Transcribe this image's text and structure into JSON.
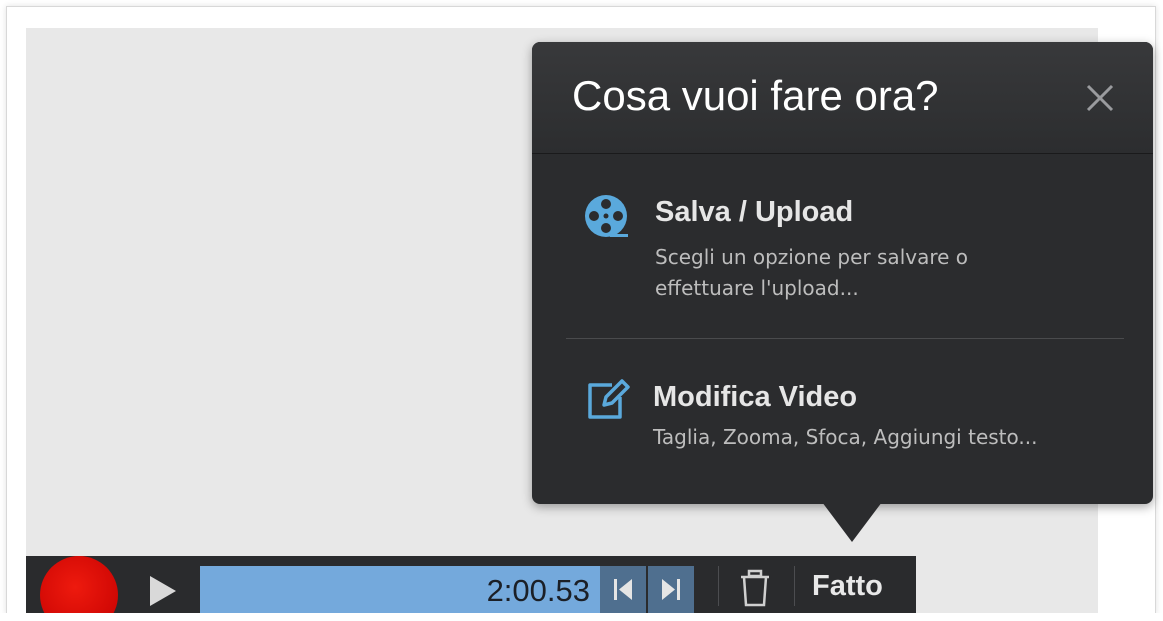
{
  "popup": {
    "title": "Cosa vuoi fare ora?",
    "close_icon": "close-icon",
    "options": [
      {
        "icon": "film-reel-icon",
        "title": "Salva / Upload",
        "description_line1": "Scegli un opzione per salvare o",
        "description_line2": "effettuare l'upload..."
      },
      {
        "icon": "edit-icon",
        "title": "Modifica Video",
        "description_line1": "Taglia, Zooma, Sfoca, Aggiungi testo..."
      }
    ]
  },
  "toolbar": {
    "time": "2:00.53",
    "done_label": "Fatto",
    "icons": [
      "record-icon",
      "play-icon",
      "skip-to-start-icon",
      "skip-to-end-icon",
      "trash-icon"
    ]
  },
  "colors": {
    "popup_bg": "#2b2c2e",
    "accent_blue": "#5aa9dc",
    "timeline": "#74a9dc",
    "record_red": "#d80000"
  }
}
